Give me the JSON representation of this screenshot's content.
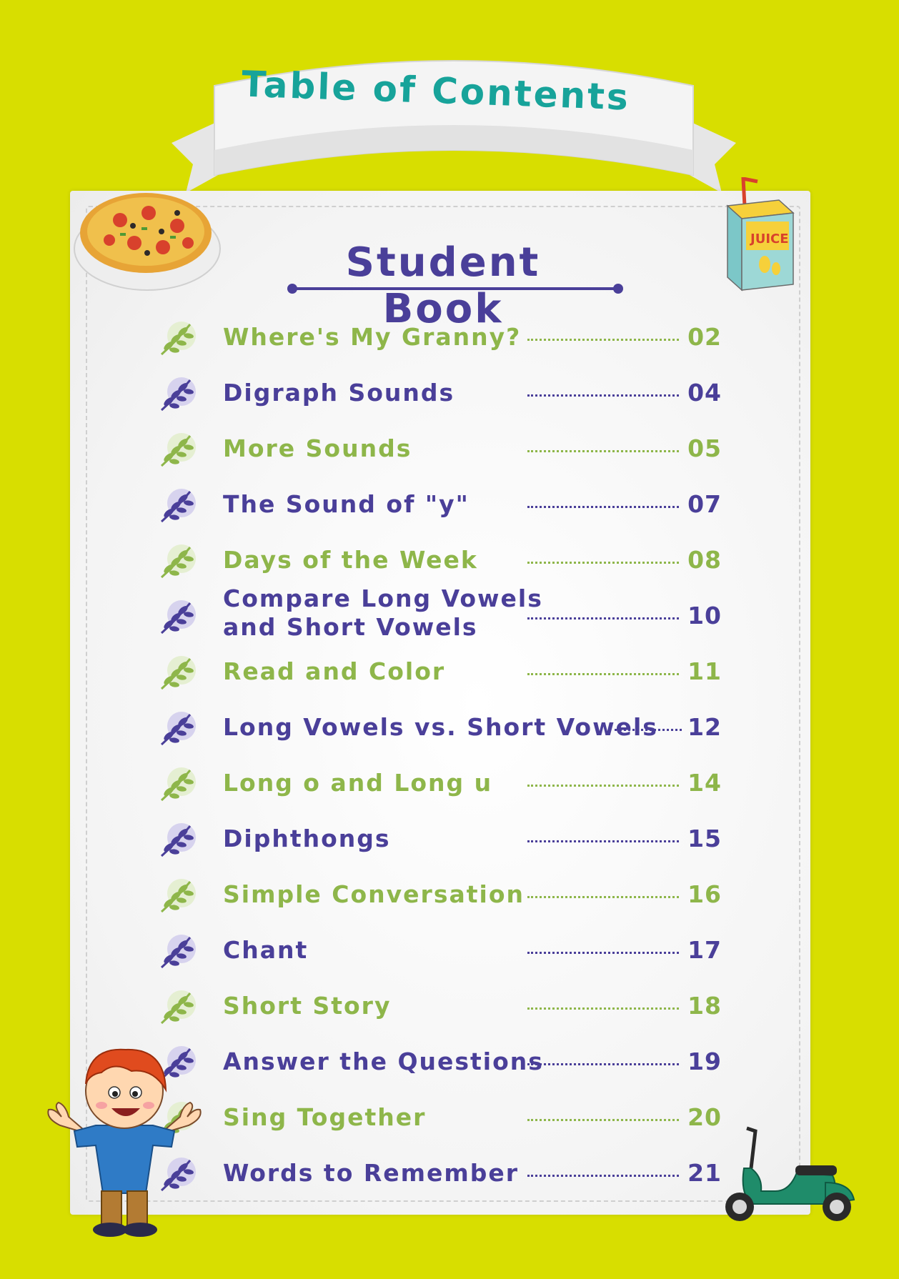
{
  "banner": {
    "title": "Table of Contents"
  },
  "section": {
    "title": "Student Book"
  },
  "juice_label": "JUICE",
  "toc": [
    {
      "label": "Where's My Granny?",
      "page": "02",
      "color": "#8eb64a"
    },
    {
      "label": "Digraph Sounds",
      "page": "04",
      "color": "#4a3f99"
    },
    {
      "label": "More Sounds",
      "page": "05",
      "color": "#8eb64a"
    },
    {
      "label": "The Sound of \"y\"",
      "page": "07",
      "color": "#4a3f99"
    },
    {
      "label": "Days of the Week",
      "page": "08",
      "color": "#8eb64a"
    },
    {
      "label_line1": "Compare Long Vowels",
      "label_line2": "and Short Vowels",
      "page": "10",
      "color": "#4a3f99"
    },
    {
      "label": "Read and Color",
      "page": "11",
      "color": "#8eb64a"
    },
    {
      "label": "Long Vowels vs. Short Vowels",
      "page": "12",
      "color": "#4a3f99"
    },
    {
      "label": "Long o and Long u",
      "page": "14",
      "color": "#8eb64a"
    },
    {
      "label": "Diphthongs",
      "page": "15",
      "color": "#4a3f99"
    },
    {
      "label": "Simple Conversation",
      "page": "16",
      "color": "#8eb64a"
    },
    {
      "label": "Chant",
      "page": "17",
      "color": "#4a3f99"
    },
    {
      "label": "Short Story",
      "page": "18",
      "color": "#8eb64a"
    },
    {
      "label": "Answer the Questions",
      "page": "19",
      "color": "#4a3f99"
    },
    {
      "label": "Sing Together",
      "page": "20",
      "color": "#8eb64a"
    },
    {
      "label": "Words to Remember",
      "page": "21",
      "color": "#4a3f99"
    }
  ],
  "colors": {
    "background": "#d8de00",
    "accent_teal": "#17a39a",
    "purple": "#4a3f99",
    "green": "#8eb64a"
  },
  "icons": [
    "leaf-icon",
    "pizza-icon",
    "juice-box-icon",
    "boy-character-icon",
    "scooter-icon"
  ]
}
